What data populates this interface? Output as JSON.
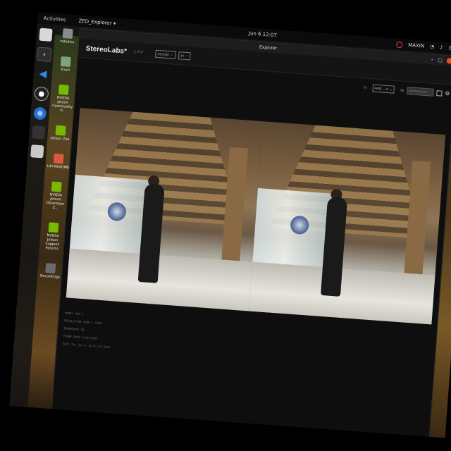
{
  "topbar": {
    "activities": "Activities",
    "app_menu": "ZED_Explorer ▾",
    "clock": "Jun 6  12:07",
    "user": "MAXIN"
  },
  "dock": {
    "items": [
      {
        "name": "files-icon",
        "color": "#d9d9d9"
      },
      {
        "name": "terminal-icon",
        "color": "#2d2d2d"
      },
      {
        "name": "vscode-icon",
        "color": "#1f7ad8"
      },
      {
        "name": "obs-icon",
        "color": "#3a3a3a"
      },
      {
        "name": "chromium-icon",
        "color": "#4a8fe0"
      },
      {
        "name": "app-icon",
        "color": "#2f2f2f"
      },
      {
        "name": "storage-icon",
        "color": "#c9c9c9"
      }
    ]
  },
  "desktop": {
    "icons": [
      {
        "label": "robotics",
        "color": "#8a8a8a"
      },
      {
        "label": "Trash",
        "color": "#7da37a"
      },
      {
        "label": "NVIDIA Jetson Community P..",
        "color": "#76b900"
      },
      {
        "label": "Jetson Zoo",
        "color": "#76b900"
      },
      {
        "label": "L4T-README",
        "color": "#d9573c"
      },
      {
        "label": "NVIDIA Jetson Developer Z..",
        "color": "#76b900"
      },
      {
        "label": "NVIDIA Jetson Support Forums",
        "color": "#76b900"
      },
      {
        "label": "Recordings",
        "color": "#6a6a6a"
      }
    ]
  },
  "window": {
    "title": "Explorer",
    "controls": {
      "minimize": "–",
      "maximize": "□"
    }
  },
  "app": {
    "brand": "StereoLabs*",
    "version": "1.7.4",
    "resolution_select": "HD1080",
    "fps_select": "30",
    "right_label": "TX",
    "right_select": "AMEL ~ 0",
    "right_label2": "SN",
    "right_field": "########"
  },
  "info": {
    "lines": [
      "MODEL  ZED 2",
      "RESOLUTION  3840 x 1080",
      "FRAMERATE  30",
      "FRAME DROP  0/5577506",
      "DATE  Thu Jun 6 12:07:19 2024"
    ]
  }
}
